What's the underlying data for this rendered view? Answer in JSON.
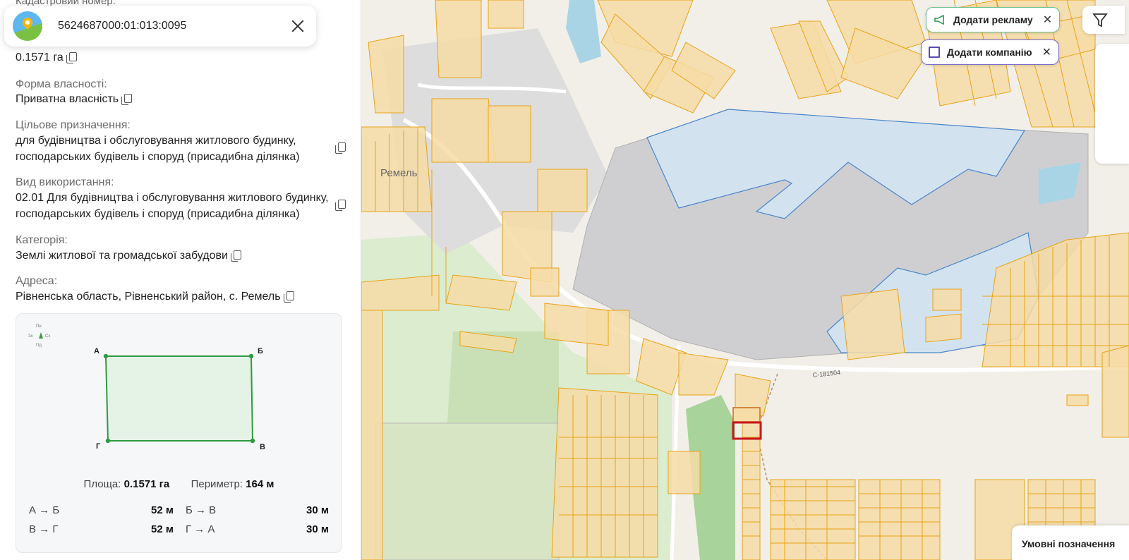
{
  "panel": {
    "cut_label": "Кадастровий номер:",
    "cadastral_number": "5624687000:01:013:0095",
    "area_value": "0.1571 га",
    "ownership_label": "Форма власності:",
    "ownership_value": "Приватна власність",
    "purpose_label": "Цільове призначення:",
    "purpose_line1": "для будівництва і обслуговування житлового будинку,",
    "purpose_line2": "господарських будівель і споруд (присадибна ділянка)",
    "usage_label": "Вид використання:",
    "usage_line1": "02.01 Для будівництва і обслуговування житлового будинку,",
    "usage_line2": "господарських будівель і споруд (присадибна ділянка)",
    "category_label": "Категорія:",
    "category_value": "Землі житлової та громадської забудови",
    "address_label": "Адреса:",
    "address_value": "Рівненська область, Рівненський район, с. Ремель"
  },
  "plan": {
    "compass": {
      "n": "Пн",
      "w": "Зх",
      "e": "Сх",
      "s": "Пд"
    },
    "vertices": {
      "a": "А",
      "b": "Б",
      "c": "В",
      "d": "Г"
    },
    "area_label": "Площа:",
    "area_value": "0.1571 га",
    "perimeter_label": "Периметр:",
    "perimeter_value": "164 м",
    "sides": [
      {
        "label": "А → Б",
        "value": "52 м"
      },
      {
        "label": "Б → В",
        "value": "30 м"
      },
      {
        "label": "В → Г",
        "value": "52 м"
      },
      {
        "label": "Г → А",
        "value": "30 м"
      }
    ]
  },
  "map": {
    "village_label": "Ремель",
    "road_label": "С-181504",
    "parcel_outline_color": "#e8a317",
    "parcel_fill_color": "#f6dca6",
    "selected_parcel_color": "#c8161d",
    "water_color": "#a9d4e6"
  },
  "buttons": {
    "add_ad": "Додати рекламу",
    "add_company": "Додати компанію",
    "legend": "Умовні позначення"
  }
}
